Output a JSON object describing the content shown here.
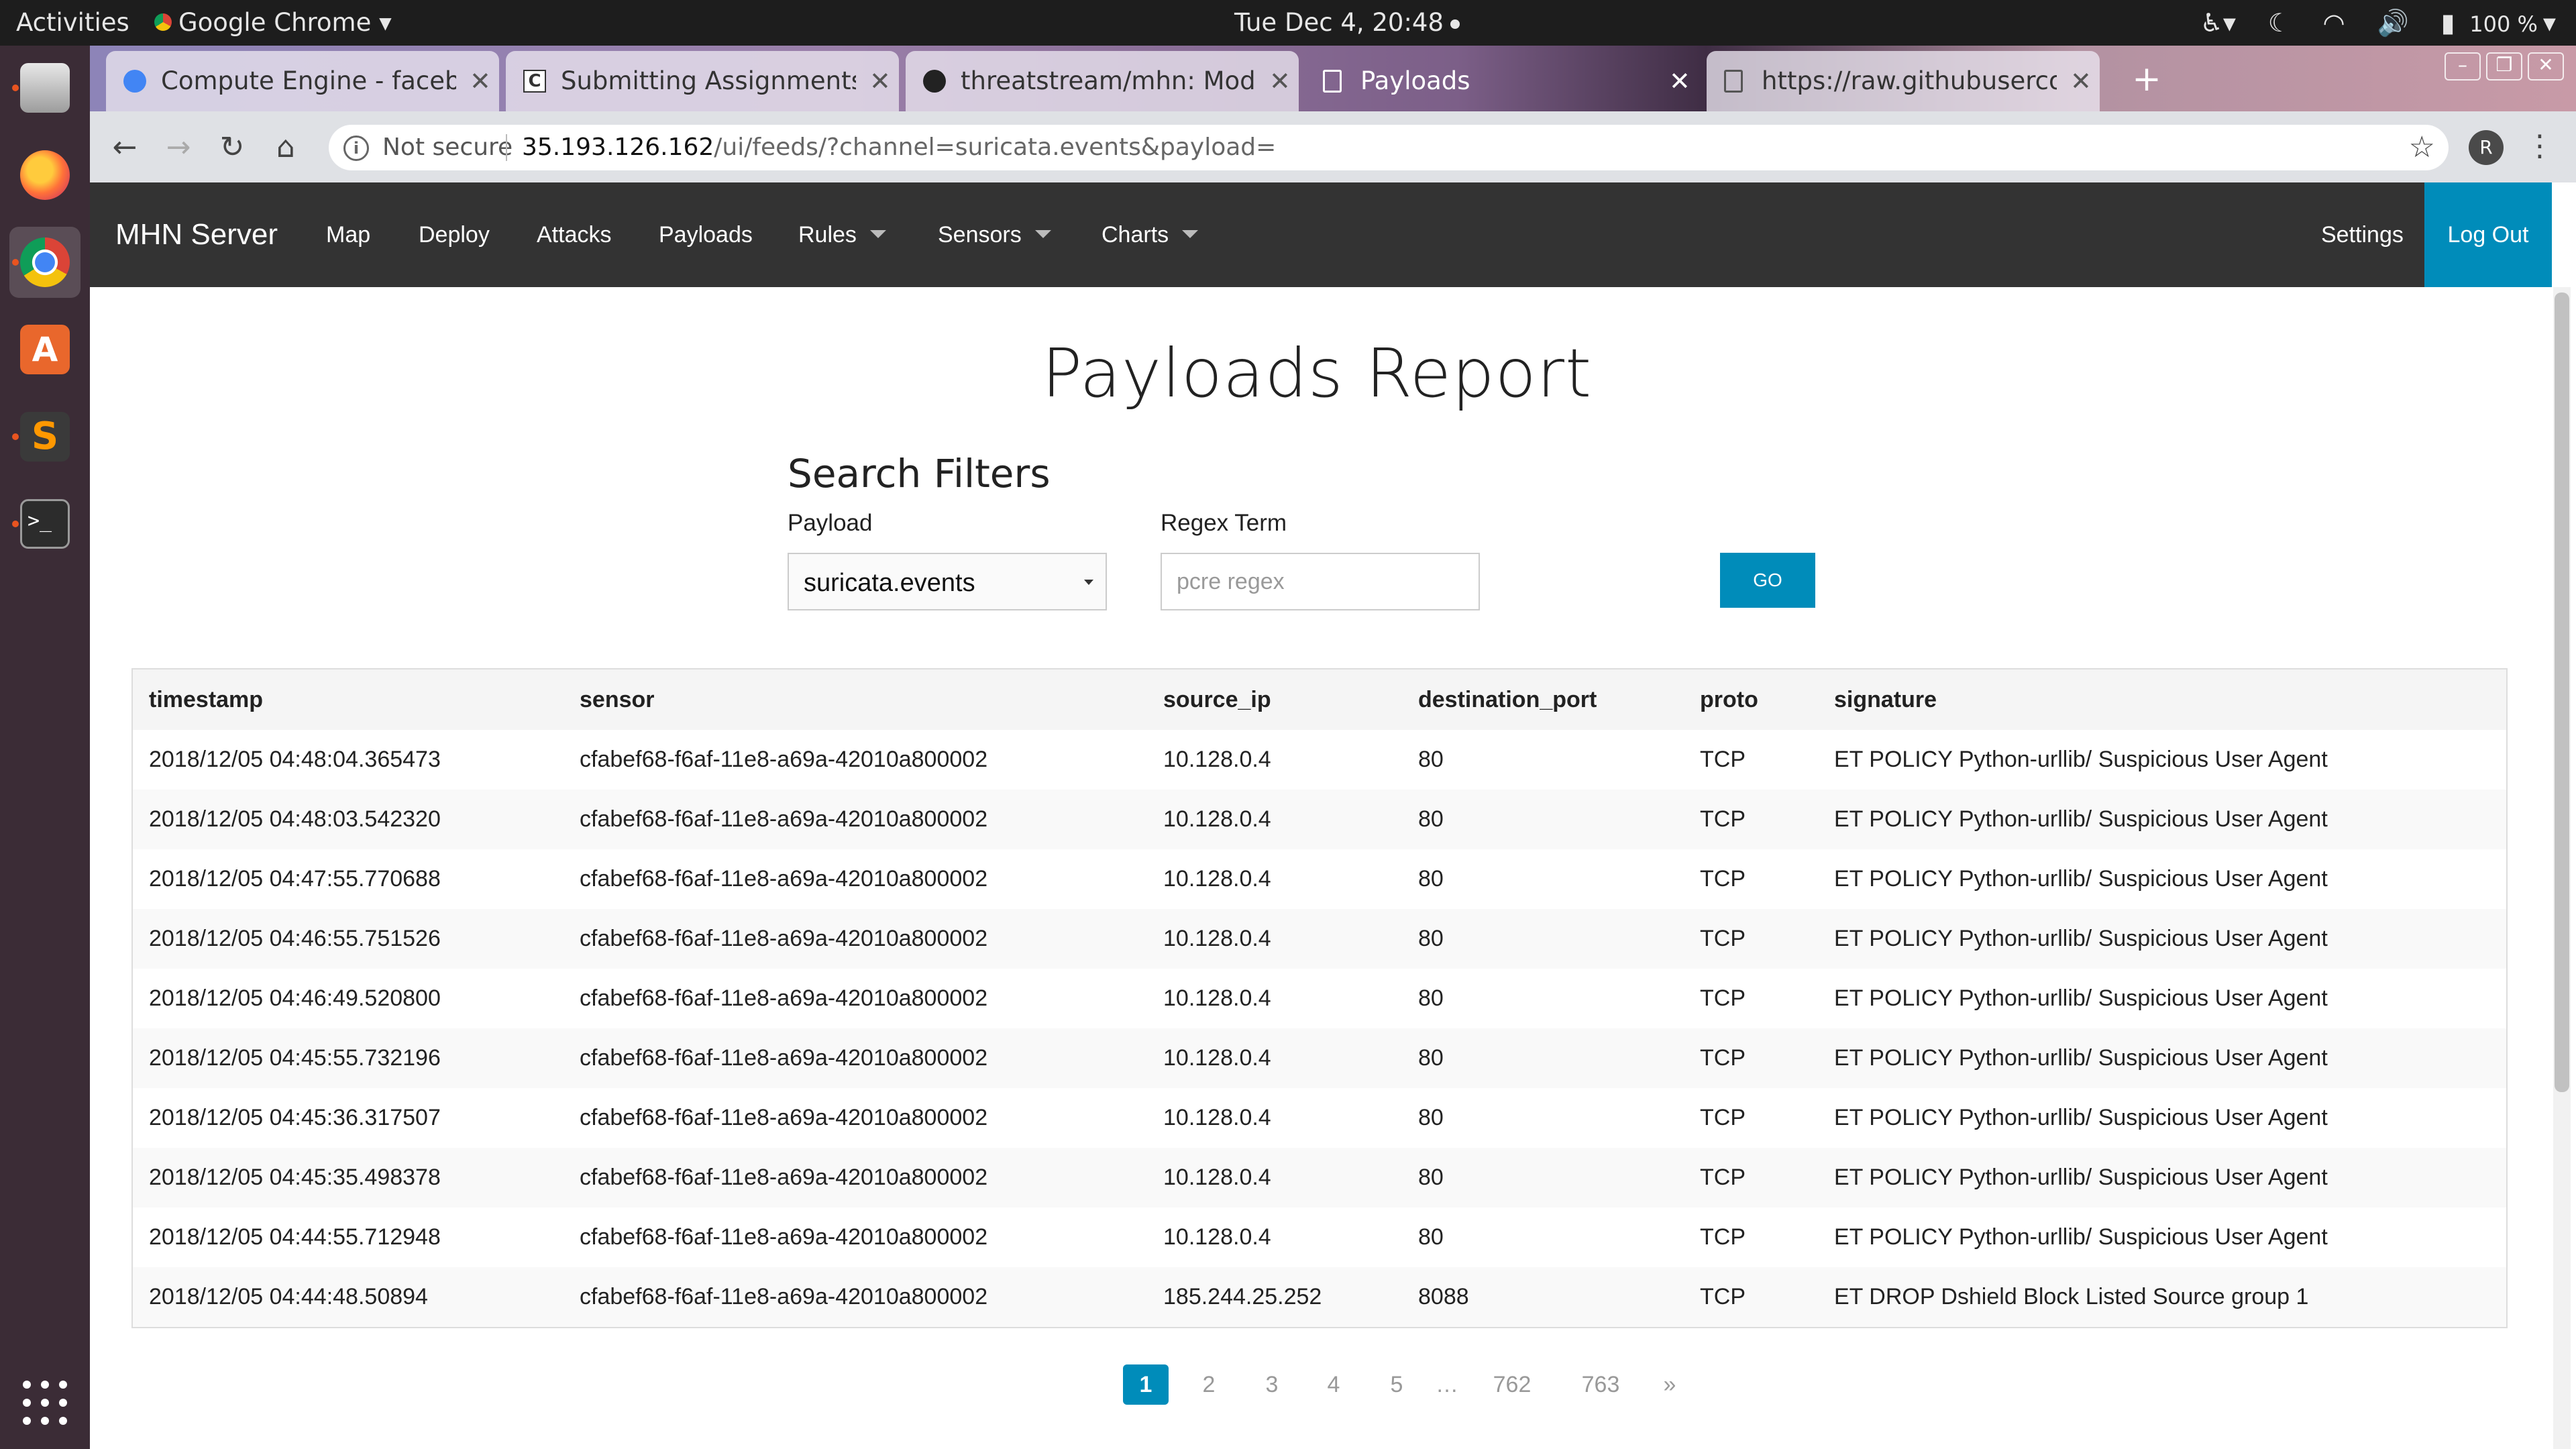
{
  "system_bar": {
    "activities": "Activities",
    "app_name": "Google Chrome",
    "clock": "Tue Dec  4, 20:48",
    "battery": "100 %"
  },
  "browser": {
    "tabs": [
      {
        "title": "Compute Engine - facebo",
        "icon": "gcp-icon"
      },
      {
        "title": "Submitting Assignments",
        "icon": "canvas-c-icon"
      },
      {
        "title": "threatstream/mhn: Mode",
        "icon": "github-icon"
      },
      {
        "title": "Payloads",
        "icon": "document-icon",
        "active": true
      },
      {
        "title": "https://raw.githubuserco",
        "icon": "document-icon"
      }
    ],
    "omnibox": {
      "not_secure": "Not secure",
      "host": "35.193.126.162",
      "path": "/ui/feeds/?channel=suricata.events&payload="
    },
    "profile_initial": "R"
  },
  "navbar": {
    "brand": "MHN Server",
    "links": [
      "Map",
      "Deploy",
      "Attacks",
      "Payloads",
      "Rules",
      "Sensors",
      "Charts"
    ],
    "settings": "Settings",
    "logout": "Log Out"
  },
  "report": {
    "title": "Payloads Report",
    "filters_title": "Search Filters",
    "payload_label": "Payload",
    "payload_value": "suricata.events",
    "regex_label": "Regex Term",
    "regex_placeholder": "pcre regex",
    "go_label": "GO"
  },
  "table": {
    "columns": [
      "timestamp",
      "sensor",
      "source_ip",
      "destination_port",
      "proto",
      "signature"
    ],
    "rows": [
      [
        "2018/12/05 04:48:04.365473",
        "cfabef68-f6af-11e8-a69a-42010a800002",
        "10.128.0.4",
        "80",
        "TCP",
        "ET POLICY Python-urllib/ Suspicious User Agent"
      ],
      [
        "2018/12/05 04:48:03.542320",
        "cfabef68-f6af-11e8-a69a-42010a800002",
        "10.128.0.4",
        "80",
        "TCP",
        "ET POLICY Python-urllib/ Suspicious User Agent"
      ],
      [
        "2018/12/05 04:47:55.770688",
        "cfabef68-f6af-11e8-a69a-42010a800002",
        "10.128.0.4",
        "80",
        "TCP",
        "ET POLICY Python-urllib/ Suspicious User Agent"
      ],
      [
        "2018/12/05 04:46:55.751526",
        "cfabef68-f6af-11e8-a69a-42010a800002",
        "10.128.0.4",
        "80",
        "TCP",
        "ET POLICY Python-urllib/ Suspicious User Agent"
      ],
      [
        "2018/12/05 04:46:49.520800",
        "cfabef68-f6af-11e8-a69a-42010a800002",
        "10.128.0.4",
        "80",
        "TCP",
        "ET POLICY Python-urllib/ Suspicious User Agent"
      ],
      [
        "2018/12/05 04:45:55.732196",
        "cfabef68-f6af-11e8-a69a-42010a800002",
        "10.128.0.4",
        "80",
        "TCP",
        "ET POLICY Python-urllib/ Suspicious User Agent"
      ],
      [
        "2018/12/05 04:45:36.317507",
        "cfabef68-f6af-11e8-a69a-42010a800002",
        "10.128.0.4",
        "80",
        "TCP",
        "ET POLICY Python-urllib/ Suspicious User Agent"
      ],
      [
        "2018/12/05 04:45:35.498378",
        "cfabef68-f6af-11e8-a69a-42010a800002",
        "10.128.0.4",
        "80",
        "TCP",
        "ET POLICY Python-urllib/ Suspicious User Agent"
      ],
      [
        "2018/12/05 04:44:55.712948",
        "cfabef68-f6af-11e8-a69a-42010a800002",
        "10.128.0.4",
        "80",
        "TCP",
        "ET POLICY Python-urllib/ Suspicious User Agent"
      ],
      [
        "2018/12/05 04:44:48.50894",
        "cfabef68-f6af-11e8-a69a-42010a800002",
        "185.244.25.252",
        "8088",
        "TCP",
        "ET DROP Dshield Block Listed Source group 1"
      ]
    ]
  },
  "pagination": {
    "pages": [
      "1",
      "2",
      "3",
      "4",
      "5",
      "…",
      "762",
      "763",
      "»"
    ],
    "current": "1"
  },
  "colors": {
    "accent": "#008cba",
    "navbar": "#333333",
    "dock": "#3b2c36"
  }
}
